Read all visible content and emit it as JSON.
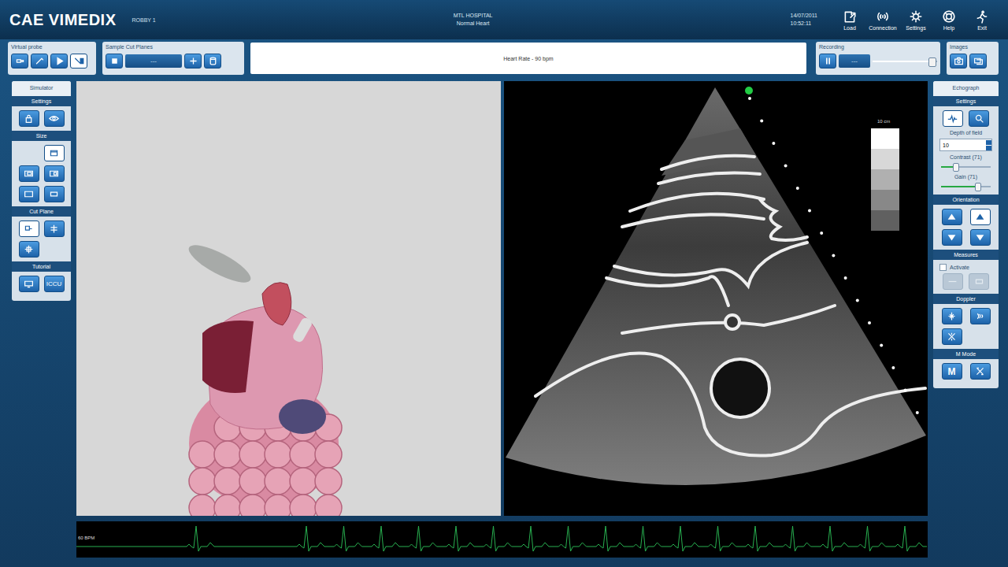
{
  "header": {
    "logo": "CAE VIMEDIX",
    "user": "ROBBY 1",
    "hospital": "MTL HOSPITAL",
    "case": "Normal Heart",
    "date": "14/07/2011",
    "time": "10:52:11",
    "actions": [
      {
        "label": "Load",
        "kind": "load"
      },
      {
        "label": "Connection",
        "kind": "connection"
      },
      {
        "label": "Settings",
        "kind": "settings"
      },
      {
        "label": "Help",
        "kind": "help"
      },
      {
        "label": "Exit",
        "kind": "exit"
      }
    ]
  },
  "toolbar": {
    "virtual_probe": {
      "title": "Virtual probe",
      "tools": [
        {
          "kind": "probe-a",
          "selected": false
        },
        {
          "kind": "probe-b",
          "selected": false
        },
        {
          "kind": "play",
          "selected": false
        },
        {
          "kind": "probe-pause",
          "selected": true
        }
      ]
    },
    "sample_cut_planes": {
      "title": "Sample Cut Planes",
      "value": "---",
      "buttons": [
        {
          "kind": "stop"
        },
        {
          "kind": "add"
        },
        {
          "kind": "database"
        }
      ]
    },
    "message": "Heart Rate - 90 bpm",
    "recording": {
      "title": "Recording",
      "value": "---",
      "level": 0.92,
      "buttons": [
        {
          "kind": "pause"
        }
      ]
    },
    "images": {
      "title": "Images",
      "buttons": [
        {
          "kind": "camera"
        },
        {
          "kind": "gallery"
        }
      ]
    }
  },
  "simulator": {
    "title": "Simulator",
    "sections": [
      {
        "title": "Settings",
        "buttons": [
          {
            "kind": "lock",
            "selected": false
          },
          {
            "kind": "eye",
            "selected": false
          }
        ]
      },
      {
        "title": "Size",
        "buttons": [
          {
            "kind": "size-1",
            "selected": true
          },
          {
            "kind": "size-2",
            "selected": false
          },
          {
            "kind": "size-3",
            "selected": false
          },
          {
            "kind": "size-4",
            "selected": false
          },
          {
            "kind": "size-5",
            "selected": false
          }
        ]
      },
      {
        "title": "Cut Plane",
        "buttons": [
          {
            "kind": "cut-1",
            "selected": true
          },
          {
            "kind": "cut-2",
            "selected": false
          },
          {
            "kind": "cut-3",
            "selected": false
          }
        ]
      },
      {
        "title": "Tutorial",
        "buttons": [
          {
            "kind": "screen",
            "selected": false
          },
          {
            "kind": "text",
            "label": "ICCU",
            "selected": false
          }
        ]
      }
    ]
  },
  "echograph": {
    "title": "Echograph",
    "settings_title": "Settings",
    "settings_buttons": [
      {
        "kind": "pulse",
        "selected": true
      },
      {
        "kind": "zoom",
        "selected": false
      }
    ],
    "depth": {
      "label": "Depth of field",
      "value": "10"
    },
    "contrast": {
      "label": "Contrast (71)",
      "level": 0.3
    },
    "gain": {
      "label": "Gain (71)",
      "level": 0.72
    },
    "orientation": {
      "title": "Orientation",
      "buttons": [
        {
          "kind": "arrow-up",
          "selected": false
        },
        {
          "kind": "arrow-up",
          "selected": true
        },
        {
          "kind": "arrow-down",
          "selected": false
        },
        {
          "kind": "arrow-down",
          "selected": false
        }
      ]
    },
    "measures": {
      "title": "Measures",
      "label": "Activate",
      "checked": false,
      "buttons": [
        {
          "kind": "measure-line",
          "disabled": true
        },
        {
          "kind": "measure-area",
          "disabled": true
        }
      ]
    },
    "doppler": {
      "title": "Doppler",
      "buttons": [
        {
          "kind": "doppler-color"
        },
        {
          "kind": "doppler-pw"
        },
        {
          "kind": "doppler-cw"
        }
      ]
    },
    "mmode": {
      "title": "M Mode",
      "buttons": [
        {
          "kind": "text",
          "label": "M"
        },
        {
          "kind": "tools"
        }
      ]
    }
  },
  "ultrasound": {
    "depth": "10 cm",
    "marker_on": true
  },
  "ecg": {
    "label": "60 BPM"
  }
}
